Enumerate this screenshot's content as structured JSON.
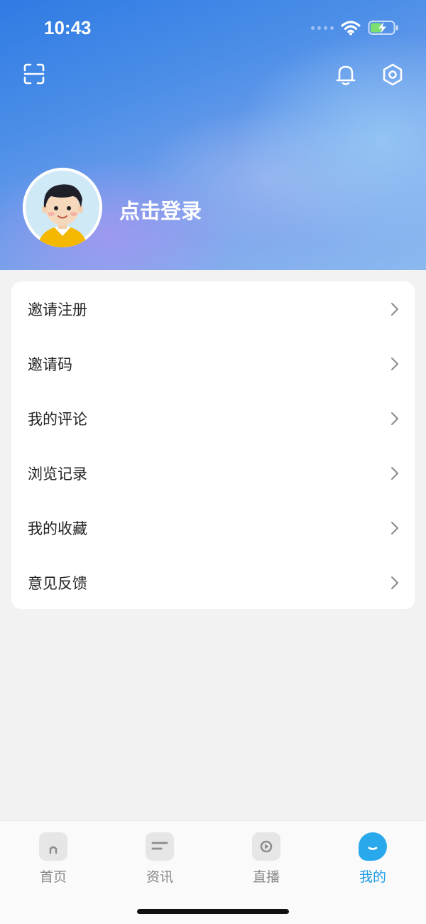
{
  "status_bar": {
    "time": "10:43"
  },
  "profile": {
    "login_prompt": "点击登录"
  },
  "menu": {
    "items": [
      {
        "label": "邀请注册"
      },
      {
        "label": "邀请码"
      },
      {
        "label": "我的评论"
      },
      {
        "label": "浏览记录"
      },
      {
        "label": "我的收藏"
      },
      {
        "label": "意见反馈"
      }
    ]
  },
  "tabbar": {
    "tabs": [
      {
        "label": "首页",
        "icon": "home-icon"
      },
      {
        "label": "资讯",
        "icon": "news-icon"
      },
      {
        "label": "直播",
        "icon": "live-icon"
      },
      {
        "label": "我的",
        "icon": "profile-icon",
        "active": true
      }
    ]
  },
  "colors": {
    "accent": "#1a9be6",
    "header_start": "#2f7be3",
    "header_end": "#8ab9ef"
  }
}
